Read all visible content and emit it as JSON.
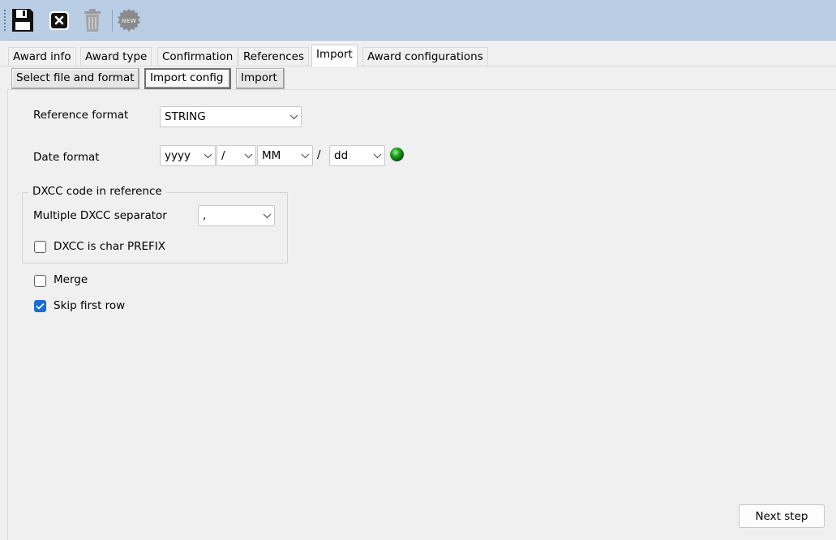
{
  "toolbar": {
    "buttons": [
      {
        "icon": "floppy-disk-icon"
      },
      {
        "icon": "close-icon"
      },
      {
        "icon": "trash-icon"
      },
      {
        "icon": "new-badge-icon",
        "text": "NEW"
      }
    ]
  },
  "tabs": [
    "Award info",
    "Award type",
    "Confirmation",
    "References",
    "Import",
    "Award configurations"
  ],
  "active_tab": "Import",
  "subtabs": [
    "Select file and format",
    "Import config",
    "Import"
  ],
  "active_subtab": "Import config",
  "form": {
    "reference_format_label": "Reference format",
    "reference_format_value": "STRING",
    "date_format_label": "Date format",
    "date_parts": {
      "year": "yyyy",
      "sep1": "/",
      "month": "MM",
      "sep2_static": "/",
      "day": "dd"
    },
    "status_color": "#1aa31a",
    "dxcc_group_title": "DXCC code in reference",
    "dxcc_separator_label": "Multiple DXCC separator",
    "dxcc_separator_value": ",",
    "dxcc_prefix_label": "DXCC is char PREFIX",
    "dxcc_prefix_checked": false,
    "merge_label": "Merge",
    "merge_checked": false,
    "skip_first_label": "Skip first row",
    "skip_first_checked": true
  },
  "next_step_label": "Next step"
}
